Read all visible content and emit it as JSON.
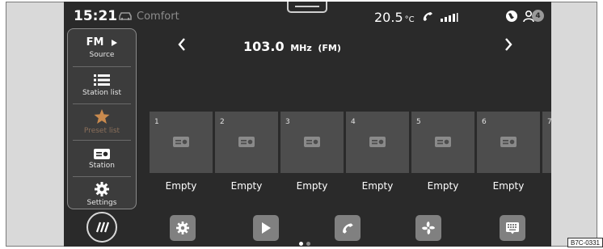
{
  "status_bar": {
    "time": "15:21",
    "drive_mode": "Comfort",
    "temperature": "20.5",
    "temperature_unit": "°C",
    "notification_count": "4"
  },
  "sidebar": {
    "items": [
      {
        "label": "Source",
        "value": "FM",
        "icon": "play-triangle-icon"
      },
      {
        "label": "Station list",
        "icon": "list-icon"
      },
      {
        "label": "Preset list",
        "icon": "star-icon",
        "state": "dimmed"
      },
      {
        "label": "Station",
        "icon": "radio-icon"
      },
      {
        "label": "Settings",
        "icon": "gear-icon"
      }
    ]
  },
  "header": {
    "frequency": "103.0",
    "unit": "MHz",
    "band": "(FM)"
  },
  "presets": [
    {
      "number": "1",
      "label": "Empty"
    },
    {
      "number": "2",
      "label": "Empty"
    },
    {
      "number": "3",
      "label": "Empty"
    },
    {
      "number": "4",
      "label": "Empty"
    },
    {
      "number": "5",
      "label": "Empty"
    },
    {
      "number": "6",
      "label": "Empty"
    },
    {
      "number": "7",
      "label": ""
    }
  ],
  "dock": {
    "items": [
      "menu-icon",
      "gear-icon",
      "play-icon",
      "phone-icon",
      "fan-icon",
      "keyboard-icon"
    ],
    "page_indicator": {
      "pages": 2,
      "active": 1
    }
  },
  "colors": {
    "screen_bg": "#2a2a2a",
    "tile_bg": "#4d4d4d",
    "accent_star": "#c98a4e"
  },
  "figure_code": "B7C-0331"
}
